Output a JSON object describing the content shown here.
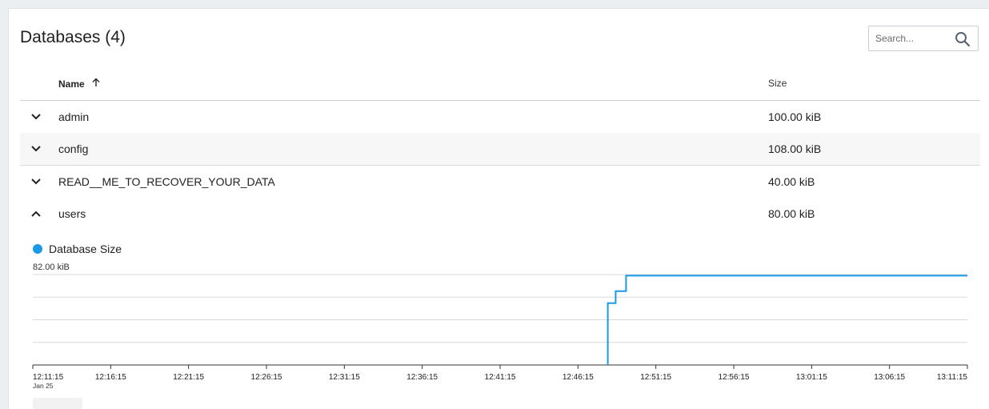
{
  "header": {
    "title": "Databases (4)",
    "search_placeholder": "Search..."
  },
  "table": {
    "columns": {
      "name": "Name",
      "size": "Size"
    },
    "rows": [
      {
        "name": "admin",
        "size": "100.00 kiB",
        "expanded": false
      },
      {
        "name": "config",
        "size": "108.00 kiB",
        "expanded": false
      },
      {
        "name": "READ__ME_TO_RECOVER_YOUR_DATA",
        "size": "40.00 kiB",
        "expanded": false
      },
      {
        "name": "users",
        "size": "80.00 kiB",
        "expanded": true
      }
    ]
  },
  "colors": {
    "series": "#1a9ae6",
    "grid": "#d6d9dc"
  },
  "chart_data": {
    "type": "line",
    "series": [
      {
        "name": "Database Size",
        "points": [
          {
            "x": "12:48:10",
            "y": 0
          },
          {
            "x": "12:48:10",
            "y": 56
          },
          {
            "x": "12:48:40",
            "y": 56
          },
          {
            "x": "12:48:40",
            "y": 67
          },
          {
            "x": "12:49:20",
            "y": 67
          },
          {
            "x": "12:49:20",
            "y": 81
          },
          {
            "x": "13:11:15",
            "y": 81
          }
        ]
      }
    ],
    "y_top_label": "82.00 kiB",
    "y_range": [
      0,
      82
    ],
    "x_ticks": [
      "12:11:15",
      "12:16:15",
      "12:21:15",
      "12:26:15",
      "12:31:15",
      "12:36:15",
      "12:41:15",
      "12:46:15",
      "12:51:15",
      "12:56:15",
      "13:01:15",
      "13:06:15",
      "13:11:15"
    ],
    "x_sublabel": "Jan 25",
    "x_range": [
      "12:11:15",
      "13:11:15"
    ],
    "grid": true,
    "legend_position": "top-left"
  }
}
